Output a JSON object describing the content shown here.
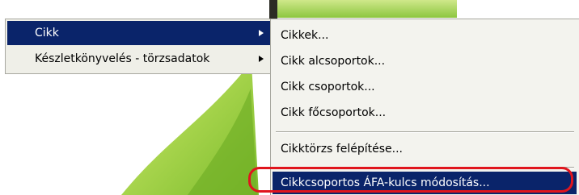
{
  "left_menu": {
    "items": [
      {
        "label": "Cikk",
        "has_submenu": true,
        "selected": true
      },
      {
        "label": "Készletkönyvelés - törzsadatok",
        "has_submenu": true,
        "selected": false
      }
    ]
  },
  "submenu": {
    "items": [
      {
        "label": "Cikkek..."
      },
      {
        "label": "Cikk alcsoportok..."
      },
      {
        "label": "Cikk csoportok..."
      },
      {
        "label": "Cikk főcsoportok..."
      },
      {
        "label": "Cikktörzs felépítése..."
      },
      {
        "label": "Cikkcsoportos ÁFA-kulcs módosítás...",
        "selected": true
      }
    ]
  },
  "colors": {
    "selection_bg": "#0a246a",
    "menu_bg": "#efefe8",
    "annotation_ring": "#e0151d",
    "background_green": "#8cc63f"
  }
}
